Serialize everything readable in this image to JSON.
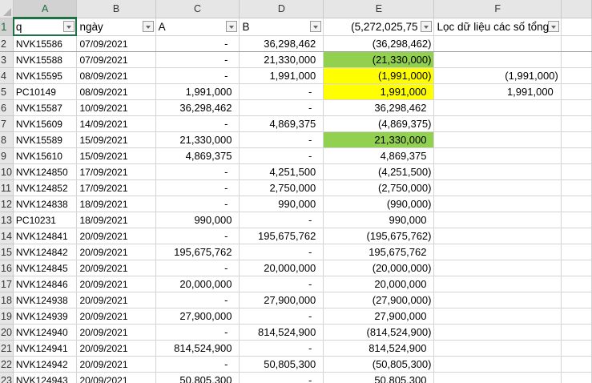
{
  "columns": [
    "A",
    "B",
    "C",
    "D",
    "E",
    "F",
    ""
  ],
  "headers": [
    "q",
    "ngày",
    "A",
    "B",
    "(5,272,025,75",
    "Lọc dữ liệu các số tổng"
  ],
  "colors": {
    "green": "#92d050",
    "yellow": "#ffff00"
  },
  "rows": [
    {
      "n": "2",
      "a": "NVK15586",
      "b": "07/09/2021",
      "c": "-",
      "d": "36,298,462",
      "e": "(36,298,462)",
      "f": "",
      "fill": ""
    },
    {
      "n": "3",
      "a": "NVK15588",
      "b": "07/09/2021",
      "c": "-",
      "d": "21,330,000",
      "e": "(21,330,000)",
      "f": "",
      "fill": "green"
    },
    {
      "n": "4",
      "a": "NVK15595",
      "b": "08/09/2021",
      "c": "-",
      "d": "1,991,000",
      "e": "(1,991,000)",
      "f": "(1,991,000)",
      "fill": "yellow"
    },
    {
      "n": "5",
      "a": "PC10149",
      "b": "08/09/2021",
      "c": "1,991,000",
      "d": "-",
      "e": "1,991,000",
      "f": "1,991,000",
      "fill": "yellow"
    },
    {
      "n": "6",
      "a": "NVK15587",
      "b": "10/09/2021",
      "c": "36,298,462",
      "d": "-",
      "e": "36,298,462",
      "f": "",
      "fill": ""
    },
    {
      "n": "7",
      "a": "NVK15609",
      "b": "14/09/2021",
      "c": "-",
      "d": "4,869,375",
      "e": "(4,869,375)",
      "f": "",
      "fill": ""
    },
    {
      "n": "8",
      "a": "NVK15589",
      "b": "15/09/2021",
      "c": "21,330,000",
      "d": "-",
      "e": "21,330,000",
      "f": "",
      "fill": "green"
    },
    {
      "n": "9",
      "a": "NVK15610",
      "b": "15/09/2021",
      "c": "4,869,375",
      "d": "-",
      "e": "4,869,375",
      "f": "",
      "fill": ""
    },
    {
      "n": "10",
      "a": "NVK124850",
      "b": "17/09/2021",
      "c": "-",
      "d": "4,251,500",
      "e": "(4,251,500)",
      "f": "",
      "fill": ""
    },
    {
      "n": "11",
      "a": "NVK124852",
      "b": "17/09/2021",
      "c": "-",
      "d": "2,750,000",
      "e": "(2,750,000)",
      "f": "",
      "fill": ""
    },
    {
      "n": "12",
      "a": "NVK124838",
      "b": "18/09/2021",
      "c": "-",
      "d": "990,000",
      "e": "(990,000)",
      "f": "",
      "fill": ""
    },
    {
      "n": "13",
      "a": "PC10231",
      "b": "18/09/2021",
      "c": "990,000",
      "d": "-",
      "e": "990,000",
      "f": "",
      "fill": ""
    },
    {
      "n": "14",
      "a": "NVK124841",
      "b": "20/09/2021",
      "c": "-",
      "d": "195,675,762",
      "e": "(195,675,762)",
      "f": "",
      "fill": ""
    },
    {
      "n": "15",
      "a": "NVK124842",
      "b": "20/09/2021",
      "c": "195,675,762",
      "d": "-",
      "e": "195,675,762",
      "f": "",
      "fill": ""
    },
    {
      "n": "16",
      "a": "NVK124845",
      "b": "20/09/2021",
      "c": "-",
      "d": "20,000,000",
      "e": "(20,000,000)",
      "f": "",
      "fill": ""
    },
    {
      "n": "17",
      "a": "NVK124846",
      "b": "20/09/2021",
      "c": "20,000,000",
      "d": "-",
      "e": "20,000,000",
      "f": "",
      "fill": ""
    },
    {
      "n": "18",
      "a": "NVK124938",
      "b": "20/09/2021",
      "c": "-",
      "d": "27,900,000",
      "e": "(27,900,000)",
      "f": "",
      "fill": ""
    },
    {
      "n": "19",
      "a": "NVK124939",
      "b": "20/09/2021",
      "c": "27,900,000",
      "d": "-",
      "e": "27,900,000",
      "f": "",
      "fill": ""
    },
    {
      "n": "20",
      "a": "NVK124940",
      "b": "20/09/2021",
      "c": "-",
      "d": "814,524,900",
      "e": "(814,524,900)",
      "f": "",
      "fill": ""
    },
    {
      "n": "21",
      "a": "NVK124941",
      "b": "20/09/2021",
      "c": "814,524,900",
      "d": "-",
      "e": "814,524,900",
      "f": "",
      "fill": ""
    },
    {
      "n": "22",
      "a": "NVK124942",
      "b": "20/09/2021",
      "c": "-",
      "d": "50,805,300",
      "e": "(50,805,300)",
      "f": "",
      "fill": ""
    },
    {
      "n": "23",
      "a": "NVK124943",
      "b": "20/09/2021",
      "c": "50,805,300",
      "d": "-",
      "e": "50,805,300",
      "f": "",
      "fill": ""
    }
  ]
}
